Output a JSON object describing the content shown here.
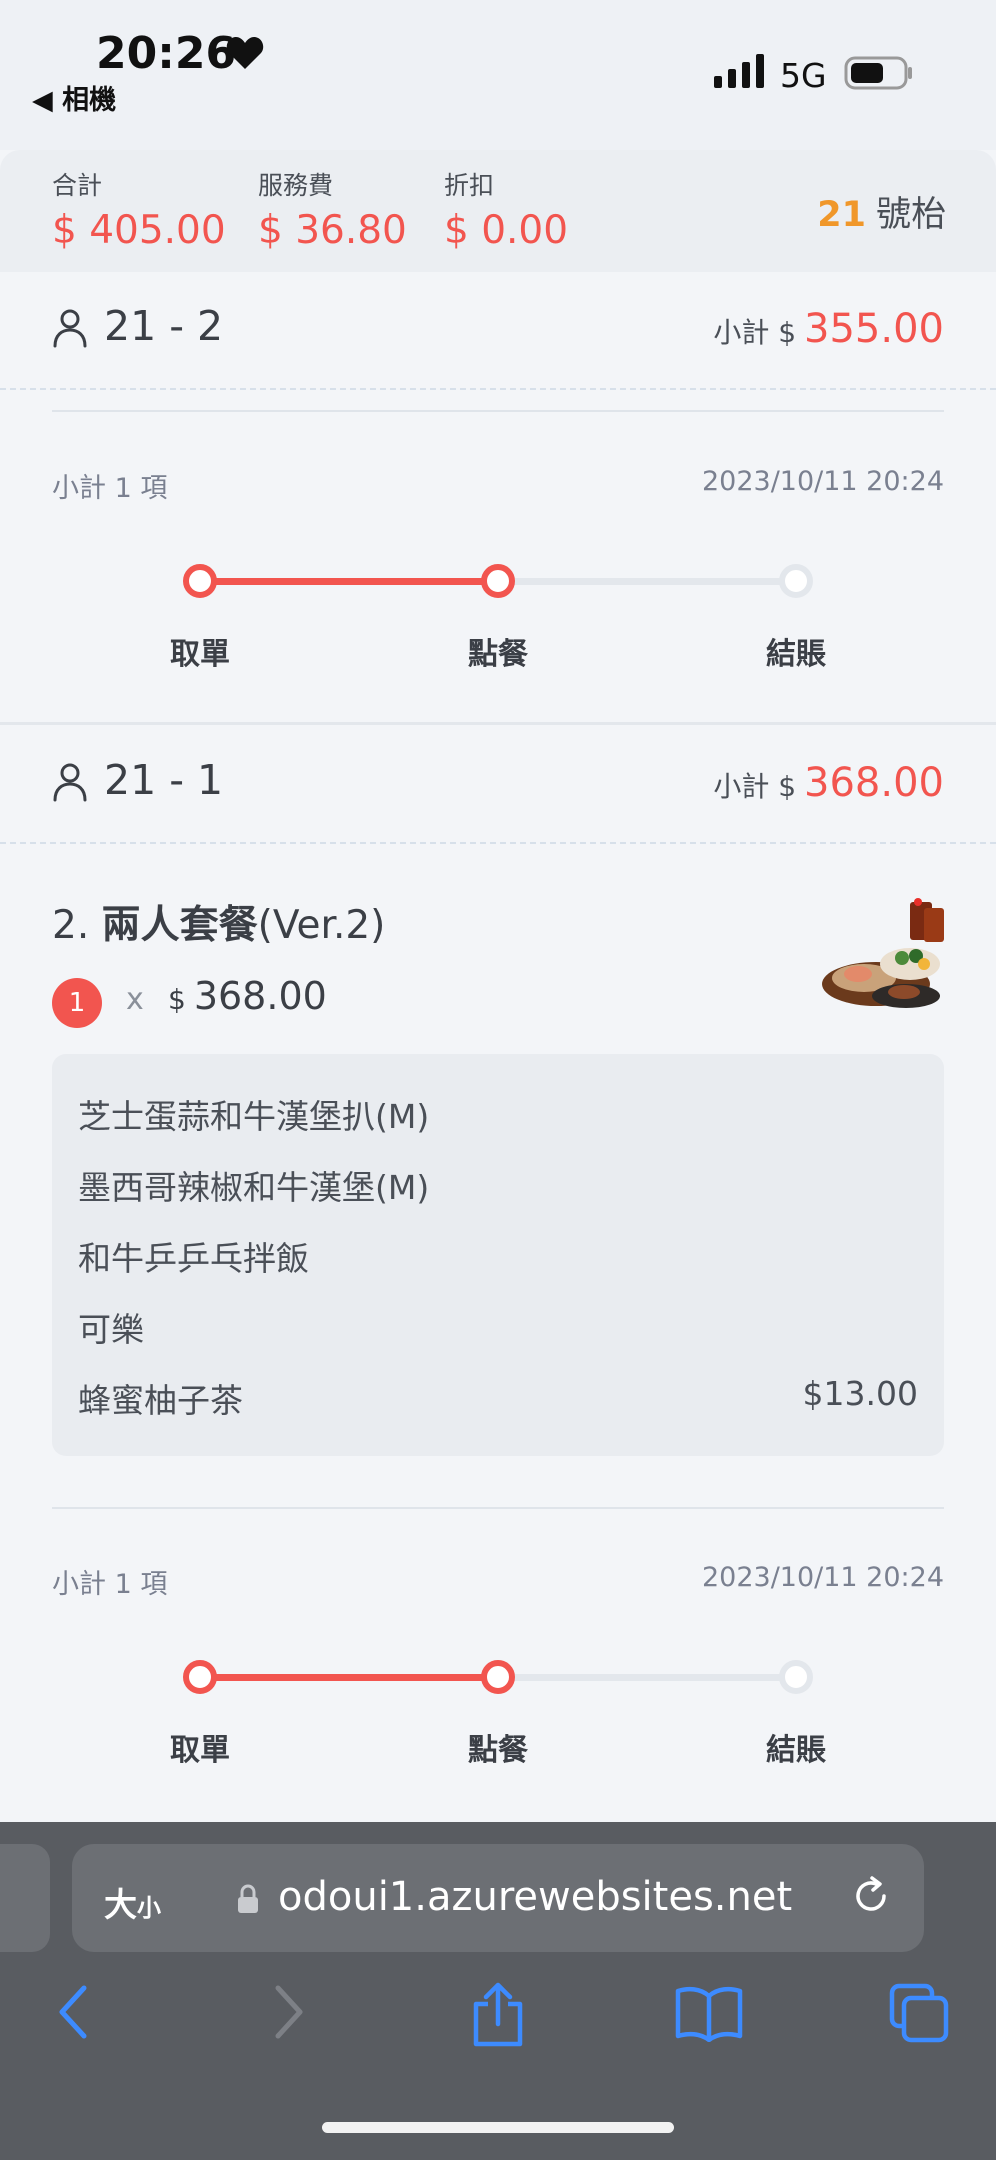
{
  "status_bar": {
    "time": "20:26",
    "back_label": "◀ 相機",
    "network": "5G"
  },
  "summary": {
    "total_label": "合計",
    "total_value": "$ 405.00",
    "service_label": "服務費",
    "service_value": "$ 36.80",
    "discount_label": "折扣",
    "discount_value": "$ 0.00",
    "table_number": "21",
    "table_suffix": "號枱"
  },
  "groups": [
    {
      "seat": "21 - 2",
      "subtotal_label": "小計 $",
      "subtotal_value": "355.00",
      "count_label": "小計 1 項",
      "datetime": "2023/10/11 20:24",
      "steps": [
        "取單",
        "點餐",
        "結賬"
      ],
      "progress": 0.5
    },
    {
      "seat": "21 - 1",
      "subtotal_label": "小計 $",
      "subtotal_value": "368.00",
      "item": {
        "index": "2.",
        "name": "兩人套餐",
        "version": "(Ver.2)",
        "quantity": "1",
        "times": "x",
        "currency": "$",
        "price": "368.00",
        "image": "set-meal-photo",
        "options": [
          {
            "name": "芝士蛋蒜和牛漢堡扒(M)",
            "price": ""
          },
          {
            "name": "墨西哥辣椒和牛漢堡(M)",
            "price": ""
          },
          {
            "name": "和牛乒乒乓拌飯",
            "price": ""
          },
          {
            "name": "可樂",
            "price": ""
          },
          {
            "name": "蜂蜜柚子茶",
            "price": "$13.00"
          }
        ]
      },
      "count_label": "小計 1 項",
      "datetime": "2023/10/11 20:24",
      "steps": [
        "取單",
        "點餐",
        "結賬"
      ],
      "progress": 0.5
    }
  ],
  "browser": {
    "text_size_label": "大",
    "text_size_small": "小",
    "url": "odoui1.azurewebsites.net"
  },
  "icons": [
    "heart-icon",
    "signal-icon",
    "battery-icon",
    "person-icon",
    "lock-icon",
    "reload-icon",
    "back-icon",
    "forward-icon",
    "share-icon",
    "bookmarks-icon",
    "tabs-icon"
  ],
  "colors": {
    "accent": "#f2554f",
    "table_number": "#f0972a",
    "browser_icons": "#3d8bff"
  }
}
